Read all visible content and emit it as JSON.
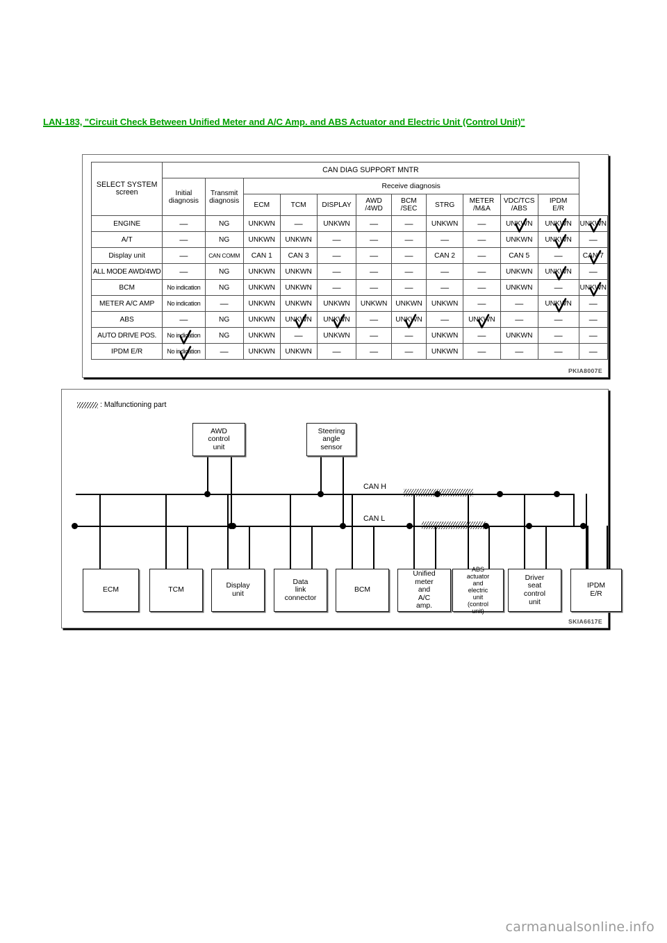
{
  "link_heading": {
    "text": "LAN-183, \"Circuit Check Between Unified Meter and A/C Amp. and ABS Actuator and Electric Unit (Control Unit)\"",
    "color": "#00a000"
  },
  "table_figure": {
    "code": "PKIA8007E",
    "headers": {
      "select_system": "SELECT SYSTEM screen",
      "can_diag": "CAN DIAG SUPPORT MNTR",
      "initial_diagnosis": "Initial diagnosis",
      "transmit_diagnosis": "Transmit diagnosis",
      "receive_diagnosis": "Receive diagnosis",
      "receive_cols": [
        "ECM",
        "TCM",
        "DISPLAY",
        "AWD /4WD",
        "BCM /SEC",
        "STRG",
        "METER /M&A",
        "VDC/TCS /ABS",
        "IPDM E/R"
      ]
    },
    "rows": [
      {
        "system": "ENGINE",
        "initial": "—",
        "transmit": "NG",
        "receive": [
          "UNKWN",
          "—",
          "UNKWN",
          "—",
          "—",
          "UNKWN",
          "—",
          "UNKWN",
          "UNKWN",
          "UNKWN"
        ],
        "checks": [
          7,
          8,
          9
        ]
      },
      {
        "system": "A/T",
        "initial": "—",
        "transmit": "NG",
        "receive": [
          "UNKWN",
          "UNKWN",
          "—",
          "—",
          "—",
          "—",
          "—",
          "UNKWN",
          "UNKWN",
          "—"
        ],
        "checks": [
          8
        ]
      },
      {
        "system": "Display unit",
        "initial": "—",
        "transmit": "CAN COMM",
        "receive": [
          "CAN 1",
          "CAN 3",
          "—",
          "—",
          "—",
          "CAN 2",
          "—",
          "CAN 5",
          "—",
          "CAN 7"
        ],
        "checks": [
          9
        ]
      },
      {
        "system": "ALL MODE AWD/4WD",
        "initial": "—",
        "transmit": "NG",
        "receive": [
          "UNKWN",
          "UNKWN",
          "—",
          "—",
          "—",
          "—",
          "—",
          "UNKWN",
          "UNKWN",
          "—"
        ],
        "checks": [
          8
        ]
      },
      {
        "system": "BCM",
        "initial": "No indication",
        "transmit": "NG",
        "receive": [
          "UNKWN",
          "UNKWN",
          "—",
          "—",
          "—",
          "—",
          "—",
          "UNKWN",
          "—",
          "UNKWN"
        ],
        "checks": [
          9
        ]
      },
      {
        "system": "METER A/C AMP",
        "initial": "No indication",
        "transmit": "—",
        "receive": [
          "UNKWN",
          "UNKWN",
          "UNKWN",
          "UNKWN",
          "UNKWN",
          "UNKWN",
          "—",
          "—",
          "UNKWN",
          "—"
        ],
        "checks": [
          8
        ]
      },
      {
        "system": "ABS",
        "initial": "—",
        "transmit": "NG",
        "receive": [
          "UNKWN",
          "UNKWN",
          "UNKWN",
          "—",
          "UNKWN",
          "—",
          "UNKWN",
          "—",
          "—",
          "—"
        ],
        "checks": [
          1,
          2,
          4,
          6
        ]
      },
      {
        "system": "AUTO DRIVE POS.",
        "initial": "No indication",
        "transmit": "NG",
        "receive": [
          "UNKWN",
          "—",
          "UNKWN",
          "—",
          "—",
          "UNKWN",
          "—",
          "UNKWN",
          "—",
          "—"
        ],
        "checks": [],
        "initial_check": true
      },
      {
        "system": "IPDM E/R",
        "initial": "No indication",
        "transmit": "—",
        "receive": [
          "UNKWN",
          "UNKWN",
          "—",
          "—",
          "—",
          "UNKWN",
          "—",
          "—",
          "—",
          "—"
        ],
        "checks": [],
        "initial_check": true
      }
    ]
  },
  "diagram_figure": {
    "code": "SKIA6617E",
    "legend_text": ": Malfunctioning part",
    "bus_labels": {
      "can_h": "CAN H",
      "can_l": "CAN L"
    },
    "top_nodes": [
      {
        "label": "AWD control unit"
      },
      {
        "label": "Steering angle sensor"
      }
    ],
    "bottom_nodes": [
      {
        "label": "ECM"
      },
      {
        "label": "TCM"
      },
      {
        "label": "Display unit"
      },
      {
        "label": "Data link connector"
      },
      {
        "label": "BCM"
      },
      {
        "label": "Unified meter and A/C amp."
      },
      {
        "label": "ABS actuator and electric unit (control unit)"
      },
      {
        "label": "Driver seat control unit"
      },
      {
        "label": "IPDM E/R"
      }
    ]
  },
  "footer": {
    "watermark": "carmanualsonline.info"
  }
}
